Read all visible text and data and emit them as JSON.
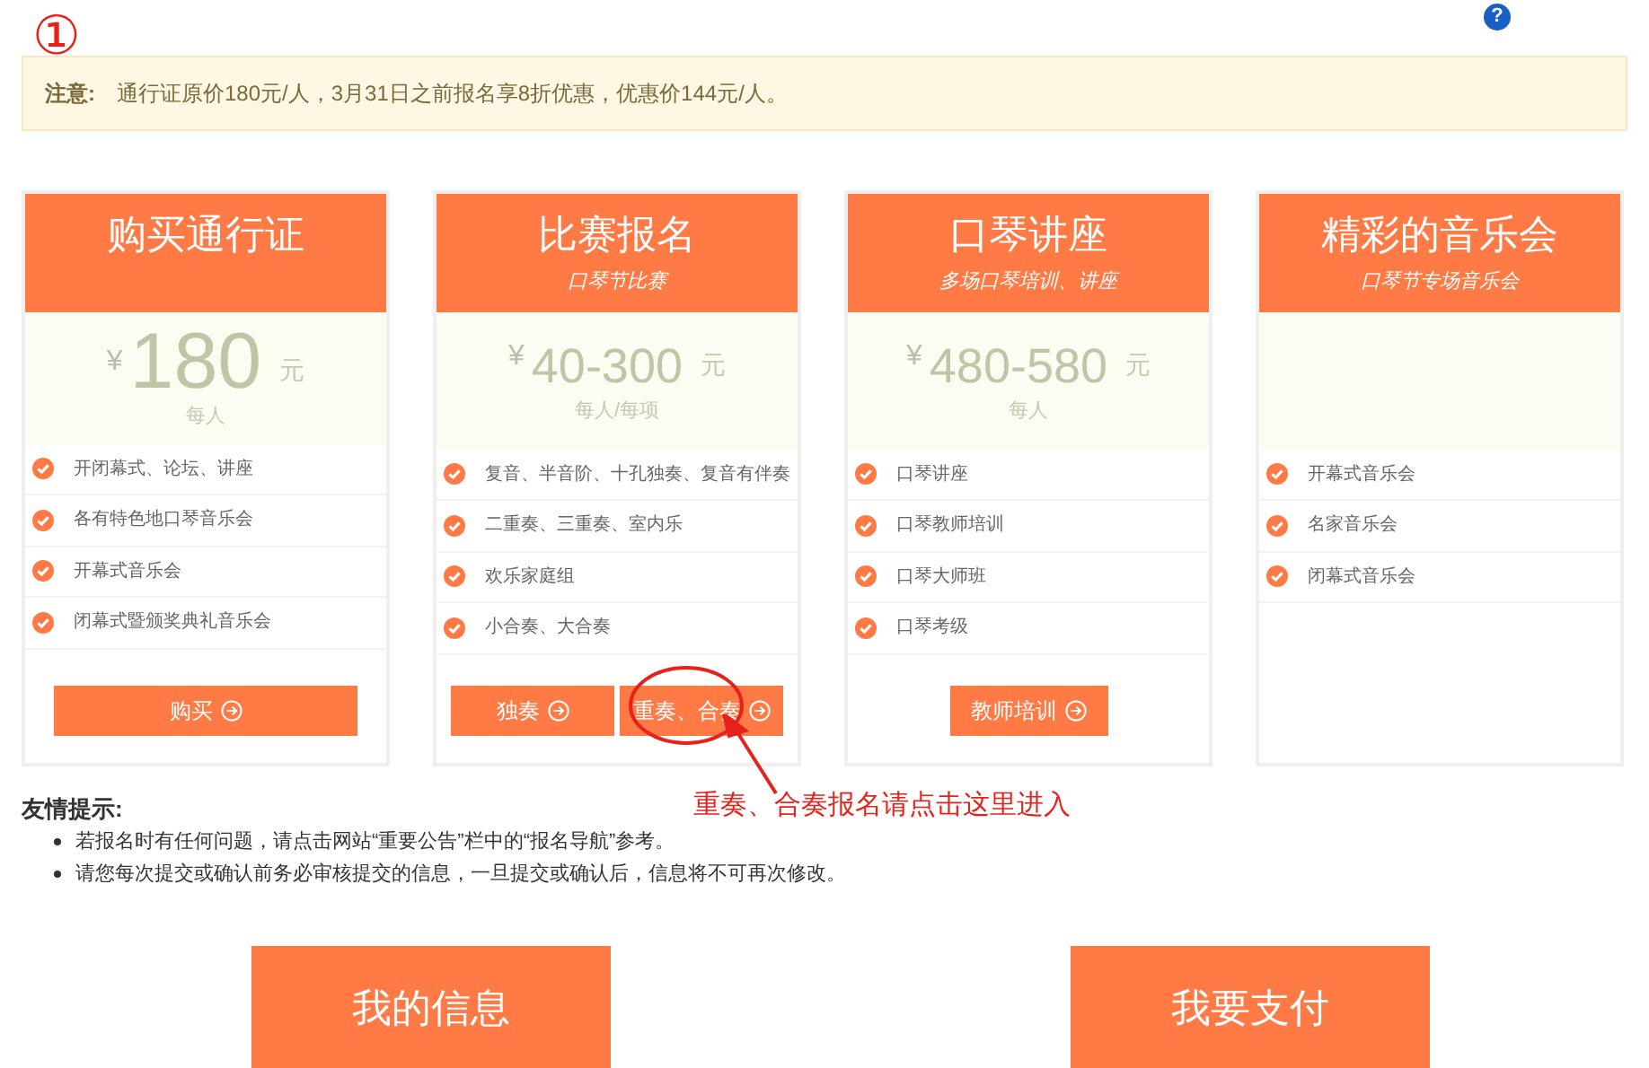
{
  "annotation_number": "①",
  "help": {
    "label": "?"
  },
  "notice": {
    "label": "注意:",
    "text": "通行证原价180元/人，3月31日之前报名享8折优惠，优惠价144元/人。"
  },
  "cards": [
    {
      "title": "购买通行证",
      "price": {
        "kind": "large",
        "currency": "¥",
        "amount": "180",
        "unit": "元",
        "per": "每人"
      },
      "features": [
        "开闭幕式、论坛、讲座",
        "各有特色地口琴音乐会",
        "开幕式音乐会",
        "闭幕式暨颁奖典礼音乐会"
      ],
      "buttons": [
        {
          "label": "购买",
          "kind": "wide",
          "circled": false
        }
      ]
    },
    {
      "title": "比赛报名",
      "subtitle": "口琴节比赛",
      "price": {
        "kind": "normal",
        "currency": "¥",
        "amount": "40-300",
        "unit": "元",
        "per": "每人/每项"
      },
      "features": [
        "复音、半音阶、十孔独奏、复音有伴奏",
        "二重奏、三重奏、室内乐",
        "欢乐家庭组",
        "小合奏、大合奏"
      ],
      "buttons": [
        {
          "label": "独奏",
          "kind": "half",
          "circled": false
        },
        {
          "label": "重奏、合奏",
          "kind": "half",
          "circled": true
        }
      ]
    },
    {
      "title": "口琴讲座",
      "subtitle": "多场口琴培训、讲座",
      "price": {
        "kind": "normal",
        "currency": "¥",
        "amount": "480-580",
        "unit": "元",
        "per": "每人"
      },
      "features": [
        "口琴讲座",
        "口琴教师培训",
        "口琴大师班",
        "口琴考级"
      ],
      "buttons": [
        {
          "label": "教师培训",
          "kind": "compact",
          "circled": false
        }
      ]
    },
    {
      "title": "精彩的音乐会",
      "subtitle": "口琴节专场音乐会",
      "features": [
        "开幕式音乐会",
        "名家音乐会",
        "闭幕式音乐会"
      ]
    }
  ],
  "annotation": {
    "text": "重奏、合奏报名请点击这里进入"
  },
  "tips": {
    "title": "友情提示:",
    "items": [
      "若报名时有任何问题，请点击网站“重要公告”栏中的“报名导航”参考。",
      "请您每次提交或确认前务必审核提交的信息，一旦提交或确认后，信息将不可再次修改。"
    ]
  },
  "actions": [
    {
      "label": "我的信息"
    },
    {
      "label": "我要支付"
    }
  ]
}
